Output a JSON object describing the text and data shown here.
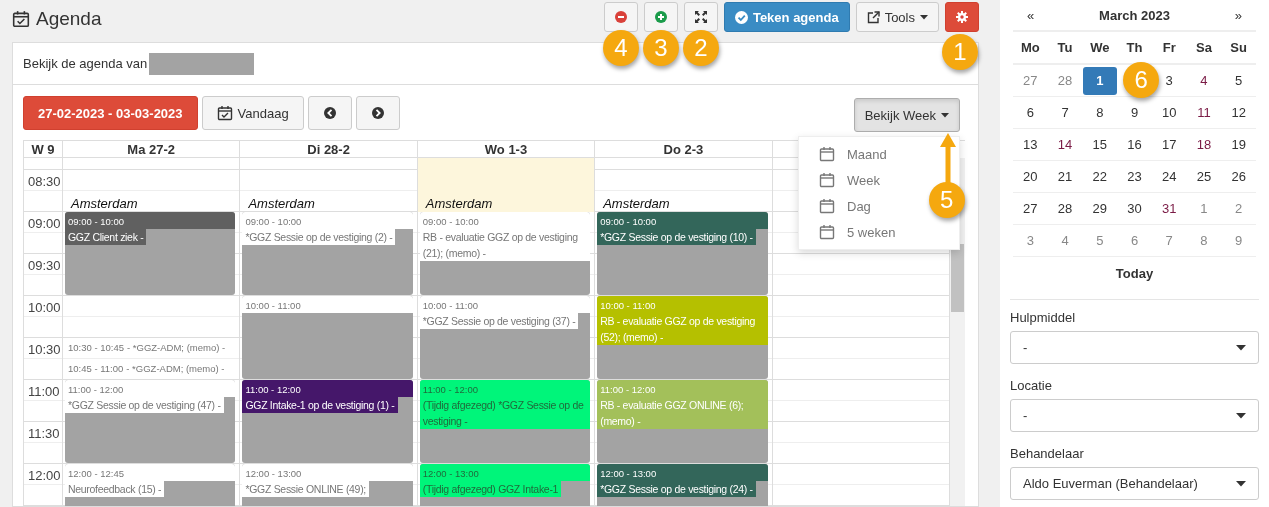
{
  "page": {
    "title": "Agenda"
  },
  "toolbar": [
    {
      "kind": "remove",
      "badge": "4"
    },
    {
      "kind": "add",
      "badge": "3"
    },
    {
      "kind": "fullscreen",
      "badge": "2"
    },
    {
      "kind": "primary",
      "label": "Teken agenda"
    },
    {
      "kind": "dropdown",
      "label": "Tools"
    },
    {
      "kind": "settings",
      "badge": "1"
    }
  ],
  "owner": {
    "label": "Bekijk de agenda van"
  },
  "range_bar": {
    "date_range": "27-02-2023 - 03-03-2023",
    "today_button": "Vandaag",
    "view_button": {
      "label": "Bekijk Week",
      "badge": "5",
      "open": true
    },
    "view_menu": [
      {
        "label": "Maand"
      },
      {
        "label": "Week"
      },
      {
        "label": "Dag"
      },
      {
        "label": "5 weken"
      }
    ]
  },
  "calendar": {
    "week": "W 9",
    "times": [
      "08:30",
      "09:00",
      "09:30",
      "10:00",
      "10:30",
      "11:00",
      "11:30",
      "12:00"
    ],
    "days": [
      {
        "label": "Ma 27-2",
        "today": false,
        "location": "Amsterdam",
        "events": [
          {
            "kind": "block",
            "time": "09:00 - 10:00",
            "title": "GGZ Client ziek -",
            "color": "#606060",
            "cancelled": false
          },
          {
            "kind": "compact",
            "time": "10:30 - 10:45",
            "title": "- *GGZ-ADM; (memo) -",
            "color": "#ffffff",
            "cancelled": false
          },
          {
            "kind": "compact",
            "time": "10:45 - 11:00",
            "title": "- *GGZ-ADM; (memo) -",
            "color": "#ffffff",
            "cancelled": false
          },
          {
            "kind": "block",
            "time": "11:00 - 12:00",
            "title": "*GGZ Sessie op de vestiging (47) -",
            "color": "#ffffff",
            "cancelled": false
          },
          {
            "kind": "block",
            "time": "12:00 - 12:45",
            "title": "Neurofeedback (15) -",
            "color": "#ffffff",
            "cancelled": false
          }
        ]
      },
      {
        "label": "Di 28-2",
        "today": false,
        "location": "Amsterdam",
        "events": [
          {
            "kind": "block",
            "time": "09:00 - 10:00",
            "title": "*GGZ Sessie op de vestiging (2) -",
            "color": "#ffffff",
            "cancelled": false
          },
          {
            "kind": "block",
            "time": "10:00 - 11:00",
            "color": "#ffffff",
            "cancelled": false
          },
          {
            "kind": "block",
            "time": "11:00 - 12:00",
            "title": "GGZ Intake-1 op de vestiging (1) -",
            "color": "#45176a",
            "cancelled": false
          },
          {
            "kind": "block",
            "time": "12:00 - 13:00",
            "title": "*GGZ Sessie ONLINE (49);",
            "color": "#ffffff",
            "cancelled": false
          }
        ]
      },
      {
        "label": "Wo 1-3",
        "today": true,
        "location": "Amsterdam",
        "events": [
          {
            "kind": "block",
            "time": "09:00 - 10:00",
            "title": "RB - evaluatie GGZ op de vestiging (21); (memo) -",
            "color": "#ffffff",
            "cancelled": false
          },
          {
            "kind": "block",
            "time": "10:00 - 11:00",
            "title": "*GGZ Sessie op de vestiging (37) -",
            "color": "#ffffff",
            "cancelled": false
          },
          {
            "kind": "block",
            "time": "11:00 - 12:00",
            "title": "(Tijdig afgezegd) *GGZ Sessie op de vestiging -",
            "color": "#00f57a",
            "cancelled": true
          },
          {
            "kind": "block",
            "time": "12:00 - 13:00",
            "title": "(Tijdig afgezegd) GGZ Intake-1",
            "color": "#00f57a",
            "cancelled": true
          }
        ]
      },
      {
        "label": "Do 2-3",
        "today": false,
        "location": "Amsterdam",
        "events": [
          {
            "kind": "block",
            "time": "09:00 - 10:00",
            "title": "*GGZ Sessie op de vestiging (10) -",
            "color": "#33665a",
            "cancelled": false
          },
          {
            "kind": "block",
            "time": "10:00 - 11:00",
            "title": "RB - evaluatie GGZ op de vestiging (52); (memo) -",
            "color": "#b5c000",
            "cancelled": false
          },
          {
            "kind": "block",
            "time": "11:00 - 12:00",
            "title": "RB - evaluatie GGZ ONLINE (6); (memo) -",
            "color": "#a3c05a",
            "cancelled": false
          },
          {
            "kind": "block",
            "time": "12:00 - 13:00",
            "title": "*GGZ Sessie op de vestiging (24) -",
            "color": "#33665a",
            "cancelled": false
          }
        ]
      }
    ]
  },
  "mini_calendar": {
    "prev": "«",
    "month": "March 2023",
    "next": "»",
    "weekdays": [
      "Mo",
      "Tu",
      "We",
      "Th",
      "Fr",
      "Sa",
      "Su"
    ],
    "weeks": [
      [
        {
          "day": "27",
          "other_month": true,
          "marked": false,
          "selected": false
        },
        {
          "day": "28",
          "other_month": true,
          "marked": false,
          "selected": false
        },
        {
          "day": "1",
          "other_month": false,
          "marked": false,
          "selected": true
        },
        {
          "badge": "6"
        },
        {
          "day": "3",
          "other_month": false,
          "marked": false,
          "selected": false
        },
        {
          "day": "4",
          "other_month": false,
          "marked": true,
          "selected": false
        },
        {
          "day": "5",
          "other_month": false,
          "marked": false,
          "selected": false
        }
      ],
      [
        {
          "day": "6",
          "other_month": false,
          "marked": false,
          "selected": false
        },
        {
          "day": "7",
          "other_month": false,
          "marked": false,
          "selected": false
        },
        {
          "day": "8",
          "other_month": false,
          "marked": false,
          "selected": false
        },
        {
          "day": "9",
          "other_month": false,
          "marked": false,
          "selected": false
        },
        {
          "day": "10",
          "other_month": false,
          "marked": false,
          "selected": false
        },
        {
          "day": "11",
          "other_month": false,
          "marked": true,
          "selected": false
        },
        {
          "day": "12",
          "other_month": false,
          "marked": false,
          "selected": false
        }
      ],
      [
        {
          "day": "13",
          "other_month": false,
          "marked": false,
          "selected": false
        },
        {
          "day": "14",
          "other_month": false,
          "marked": true,
          "selected": false
        },
        {
          "day": "15",
          "other_month": false,
          "marked": false,
          "selected": false
        },
        {
          "day": "16",
          "other_month": false,
          "marked": false,
          "selected": false
        },
        {
          "day": "17",
          "other_month": false,
          "marked": false,
          "selected": false
        },
        {
          "day": "18",
          "other_month": false,
          "marked": true,
          "selected": false
        },
        {
          "day": "19",
          "other_month": false,
          "marked": false,
          "selected": false
        }
      ],
      [
        {
          "day": "20",
          "other_month": false,
          "marked": false,
          "selected": false
        },
        {
          "day": "21",
          "other_month": false,
          "marked": false,
          "selected": false
        },
        {
          "day": "22",
          "other_month": false,
          "marked": false,
          "selected": false
        },
        {
          "day": "23",
          "other_month": false,
          "marked": false,
          "selected": false
        },
        {
          "day": "24",
          "other_month": false,
          "marked": false,
          "selected": false
        },
        {
          "day": "25",
          "other_month": false,
          "marked": false,
          "selected": false
        },
        {
          "day": "26",
          "other_month": false,
          "marked": false,
          "selected": false
        }
      ],
      [
        {
          "day": "27",
          "other_month": false,
          "marked": false,
          "selected": false
        },
        {
          "day": "28",
          "other_month": false,
          "marked": false,
          "selected": false
        },
        {
          "day": "29",
          "other_month": false,
          "marked": false,
          "selected": false
        },
        {
          "day": "30",
          "other_month": false,
          "marked": false,
          "selected": false
        },
        {
          "day": "31",
          "other_month": false,
          "marked": true,
          "selected": false
        },
        {
          "day": "1",
          "other_month": true,
          "marked": false,
          "selected": false
        },
        {
          "day": "2",
          "other_month": true,
          "marked": false,
          "selected": false
        }
      ],
      [
        {
          "day": "3",
          "other_month": true,
          "marked": false,
          "selected": false
        },
        {
          "day": "4",
          "other_month": true,
          "marked": false,
          "selected": false
        },
        {
          "day": "5",
          "other_month": true,
          "marked": false,
          "selected": false
        },
        {
          "day": "6",
          "other_month": true,
          "marked": false,
          "selected": false
        },
        {
          "day": "7",
          "other_month": true,
          "marked": false,
          "selected": false
        },
        {
          "day": "8",
          "other_month": true,
          "marked": false,
          "selected": false
        },
        {
          "day": "9",
          "other_month": true,
          "marked": false,
          "selected": false
        }
      ]
    ],
    "today_button": "Today"
  },
  "filters": [
    {
      "label": "Hulpmiddel",
      "value": "-"
    },
    {
      "label": "Locatie",
      "value": "-"
    },
    {
      "label": "Behandelaar",
      "value": "Aldo Euverman (Behandelaar)"
    }
  ]
}
